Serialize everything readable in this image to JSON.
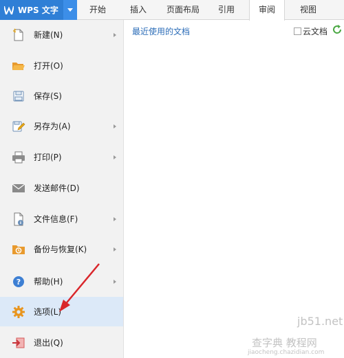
{
  "app": {
    "name": "WPS 文字"
  },
  "tabs": [
    "开始",
    "插入",
    "页面布局",
    "引用",
    "审阅",
    "视图"
  ],
  "active_tab": "审阅",
  "menu": [
    {
      "label": "新建(N)",
      "icon": "new-document-icon",
      "submenu": true
    },
    {
      "label": "打开(O)",
      "icon": "folder-open-icon",
      "submenu": false
    },
    {
      "label": "保存(S)",
      "icon": "save-icon",
      "submenu": false
    },
    {
      "label": "另存为(A)",
      "icon": "save-as-icon",
      "submenu": true
    },
    {
      "label": "打印(P)",
      "icon": "printer-icon",
      "submenu": true
    },
    {
      "label": "发送邮件(D)",
      "icon": "mail-icon",
      "submenu": false
    },
    {
      "label": "文件信息(F)",
      "icon": "file-info-icon",
      "submenu": true
    },
    {
      "label": "备份与恢复(K)",
      "icon": "backup-icon",
      "submenu": true
    },
    {
      "label": "帮助(H)",
      "icon": "help-icon",
      "submenu": true
    },
    {
      "label": "选项(L)",
      "icon": "gear-icon",
      "submenu": false
    },
    {
      "label": "退出(Q)",
      "icon": "exit-icon",
      "submenu": false
    }
  ],
  "recent": {
    "title": "最近使用的文档",
    "cloud_label": "云文档"
  },
  "watermark": {
    "line1": "jb51.net",
    "line2": "查字典 教程网",
    "line3": "jiaocheng.chazidian.com"
  },
  "colors": {
    "accent": "#2f7fd6",
    "highlight": "#dce9f8",
    "annotation_arrow": "#d9262b"
  }
}
